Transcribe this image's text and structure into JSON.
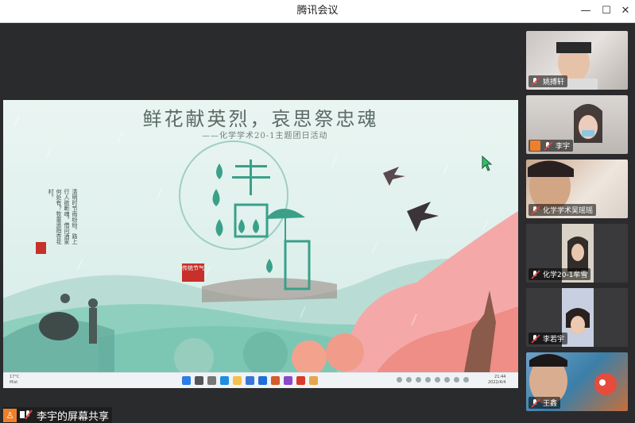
{
  "app": {
    "title": "腾讯会议"
  },
  "window_controls": {
    "minimize": "—",
    "maximize": "☐",
    "close": "✕"
  },
  "shared_screen": {
    "poster_title": "鲜花献英烈，哀思祭忠魂",
    "poster_subtitle": "——化学学术20-1主题团日活动",
    "poem": "清明时节雨纷纷，路上行人欲断魂。借问酒家何处有？牧童遥指杏花村。",
    "seal_text": "传统节气",
    "taskbar": {
      "weather_temp": "17°C",
      "weather_desc": "Mist",
      "time": "21:44",
      "date": "2022/4/4"
    }
  },
  "share_label": "李宇的屏幕共享",
  "participants": [
    {
      "name": "姚搏轩",
      "has_orange_badge": false
    },
    {
      "name": "李宇",
      "has_orange_badge": true
    },
    {
      "name": "化学学术吴瑶瑶",
      "has_orange_badge": false
    },
    {
      "name": "化学20-1牟雪",
      "has_orange_badge": false
    },
    {
      "name": "李若宇",
      "has_orange_badge": false
    },
    {
      "name": "王鑫",
      "has_orange_badge": false
    }
  ],
  "colors": {
    "accent_orange": "#f07f2a",
    "seal_red": "#c8302b",
    "mic_red": "#e0463a"
  }
}
